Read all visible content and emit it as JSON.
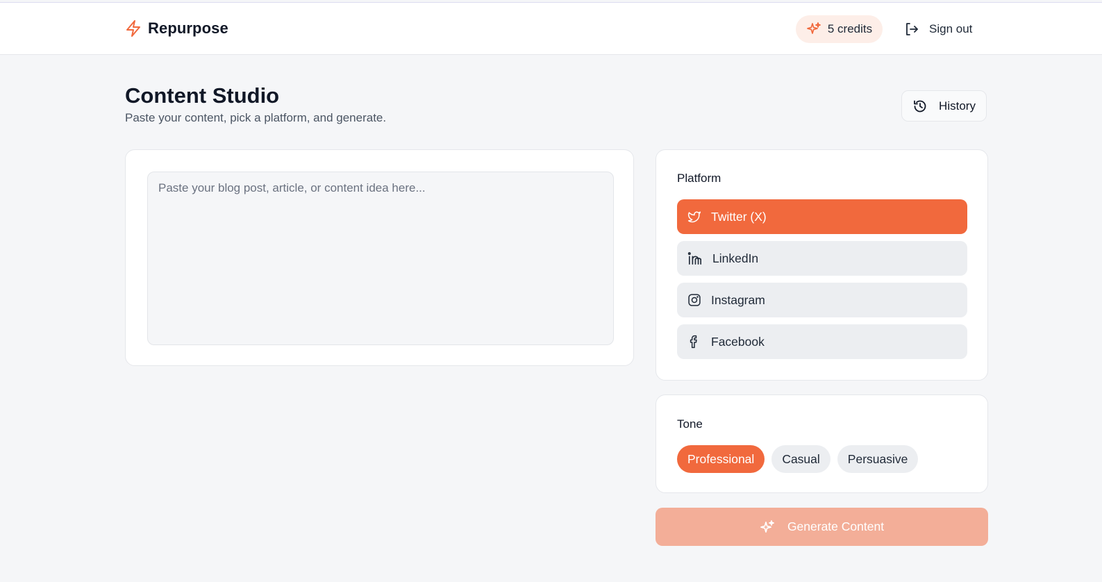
{
  "app": {
    "name": "Repurpose"
  },
  "header": {
    "credits_label": "5 credits",
    "signout_label": "Sign out"
  },
  "page": {
    "title": "Content Studio",
    "subtitle": "Paste your content, pick a platform, and generate.",
    "history_label": "History"
  },
  "editor": {
    "placeholder": "Paste your blog post, article, or content idea here...",
    "value": ""
  },
  "platform": {
    "label": "Platform",
    "selected": "Twitter (X)",
    "options": [
      {
        "label": "Twitter (X)",
        "icon": "twitter-icon"
      },
      {
        "label": "LinkedIn",
        "icon": "linkedin-icon"
      },
      {
        "label": "Instagram",
        "icon": "instagram-icon"
      },
      {
        "label": "Facebook",
        "icon": "facebook-icon"
      }
    ]
  },
  "tone": {
    "label": "Tone",
    "selected": "Professional",
    "options": [
      "Professional",
      "Casual",
      "Persuasive"
    ]
  },
  "generate": {
    "label": "Generate Content",
    "disabled": true
  },
  "colors": {
    "accent": "#f1693d",
    "accent_disabled": "#f3ae98",
    "credits_bg": "#fdeee8",
    "background": "#f5f6f8"
  }
}
